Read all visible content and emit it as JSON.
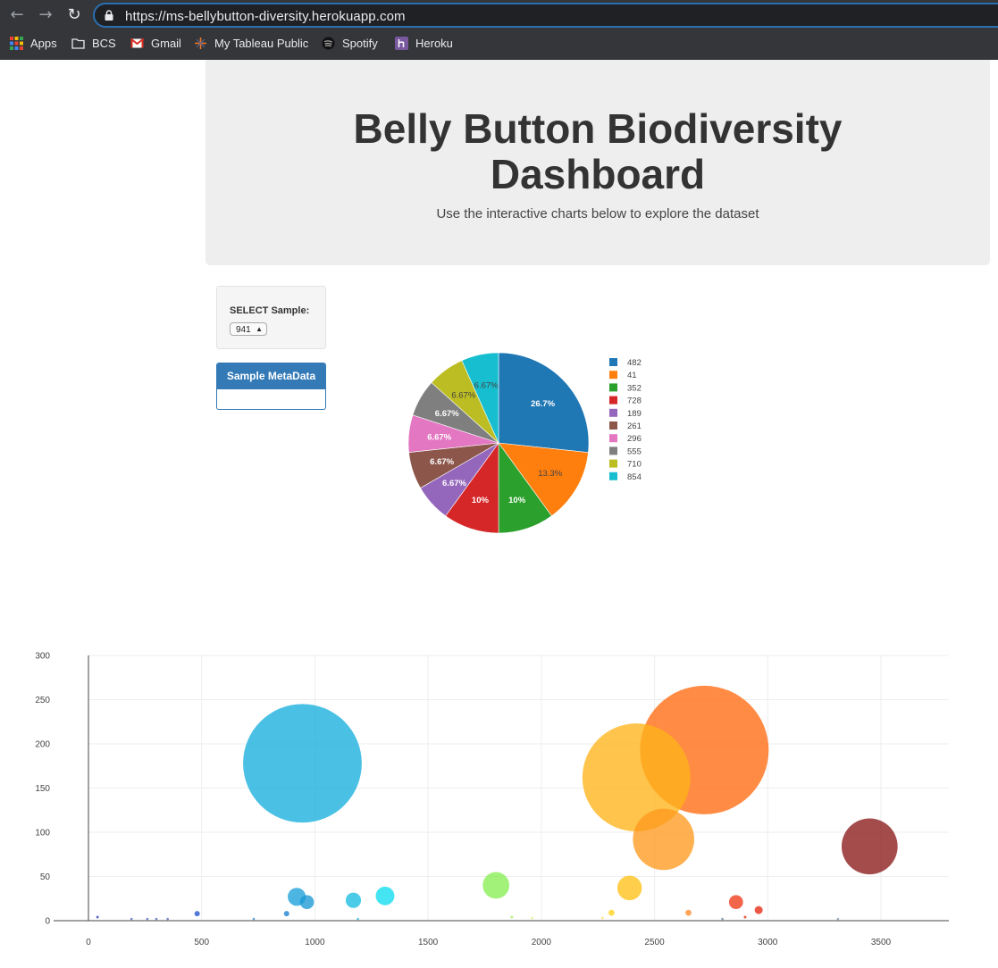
{
  "browser": {
    "url": "https://ms-bellybutton-diversity.herokuapp.com",
    "bookmarks": [
      "Apps",
      "BCS",
      "Gmail",
      "My Tableau Public",
      "Spotify",
      "Heroku"
    ]
  },
  "header": {
    "title_line1": "Belly Button Biodiversity",
    "title_line2": "Dashboard",
    "subtitle": "Use the interactive charts below to explore the dataset"
  },
  "selector": {
    "label": "SELECT Sample:",
    "value": "941"
  },
  "metadata_panel": {
    "title": "Sample MetaData"
  },
  "colors": {
    "panel_blue": "#337ab7",
    "jumbotron": "#eeeeee"
  },
  "chart_data": [
    {
      "type": "pie",
      "labels": [
        "482",
        "41",
        "352",
        "728",
        "189",
        "261",
        "296",
        "555",
        "710",
        "854"
      ],
      "values": [
        26.7,
        13.3,
        10,
        10,
        6.67,
        6.67,
        6.67,
        6.67,
        6.67,
        6.67
      ],
      "value_labels": [
        "26.7%",
        "13.3%",
        "10%",
        "10%",
        "6.67%",
        "6.67%",
        "6.67%",
        "6.67%",
        "6.67%",
        "6.67%"
      ],
      "colors": [
        "#1f77b4",
        "#ff7f0e",
        "#2ca02c",
        "#d62728",
        "#9467bd",
        "#8c564b",
        "#e377c2",
        "#7f7f7f",
        "#bcbd22",
        "#17becf"
      ],
      "legend_position": "right"
    },
    {
      "type": "scatter",
      "xlim": [
        0,
        3800
      ],
      "ylim": [
        0,
        300
      ],
      "x_ticks": [
        0,
        500,
        1000,
        1500,
        2000,
        2500,
        3000,
        3500
      ],
      "y_ticks": [
        0,
        50,
        100,
        150,
        200,
        250,
        300
      ],
      "grid": true,
      "points": [
        {
          "x": 945,
          "y": 178,
          "size": 178,
          "color": "#17b0dc"
        },
        {
          "x": 2420,
          "y": 162,
          "size": 162,
          "color": "#ffb31a"
        },
        {
          "x": 2720,
          "y": 193,
          "size": 193,
          "color": "#ff6a10"
        },
        {
          "x": 2540,
          "y": 92,
          "size": 92,
          "color": "#ff9a1f"
        },
        {
          "x": 3450,
          "y": 84,
          "size": 84,
          "color": "#8b1a1a"
        },
        {
          "x": 1800,
          "y": 40,
          "size": 40,
          "color": "#88ee55"
        },
        {
          "x": 2390,
          "y": 37,
          "size": 37,
          "color": "#ffc21a"
        },
        {
          "x": 1310,
          "y": 28,
          "size": 28,
          "color": "#11ddee"
        },
        {
          "x": 920,
          "y": 27,
          "size": 27,
          "color": "#1aa0d8"
        },
        {
          "x": 1170,
          "y": 23,
          "size": 23,
          "color": "#18bce0"
        },
        {
          "x": 965,
          "y": 21,
          "size": 21,
          "color": "#1a99d4"
        },
        {
          "x": 2860,
          "y": 21,
          "size": 21,
          "color": "#f03a18"
        },
        {
          "x": 2960,
          "y": 12,
          "size": 12,
          "color": "#e52a12"
        },
        {
          "x": 2310,
          "y": 9,
          "size": 9,
          "color": "#ffd21a"
        },
        {
          "x": 2650,
          "y": 9,
          "size": 9,
          "color": "#ff8a2a"
        },
        {
          "x": 480,
          "y": 8,
          "size": 8,
          "color": "#2255cc"
        },
        {
          "x": 875,
          "y": 8,
          "size": 8,
          "color": "#1a80d0"
        },
        {
          "x": 40,
          "y": 4,
          "size": 4,
          "color": "#3344bb"
        },
        {
          "x": 2900,
          "y": 4,
          "size": 4,
          "color": "#e03010"
        },
        {
          "x": 1870,
          "y": 4,
          "size": 4,
          "color": "#aaee66"
        },
        {
          "x": 1960,
          "y": 3,
          "size": 3,
          "color": "#ddee77"
        },
        {
          "x": 2270,
          "y": 3,
          "size": 3,
          "color": "#ffdd55"
        },
        {
          "x": 190,
          "y": 2,
          "size": 2,
          "color": "#5566bb"
        },
        {
          "x": 260,
          "y": 2,
          "size": 2,
          "color": "#5566bb"
        },
        {
          "x": 300,
          "y": 2,
          "size": 2,
          "color": "#5566bb"
        },
        {
          "x": 350,
          "y": 2,
          "size": 2,
          "color": "#5566bb"
        },
        {
          "x": 730,
          "y": 2,
          "size": 2,
          "color": "#3388cc"
        },
        {
          "x": 1190,
          "y": 2,
          "size": 2,
          "color": "#22bbdd"
        },
        {
          "x": 2800,
          "y": 2,
          "size": 2,
          "color": "#6688aa"
        },
        {
          "x": 3310,
          "y": 2,
          "size": 2,
          "color": "#8899aa"
        }
      ]
    }
  ]
}
